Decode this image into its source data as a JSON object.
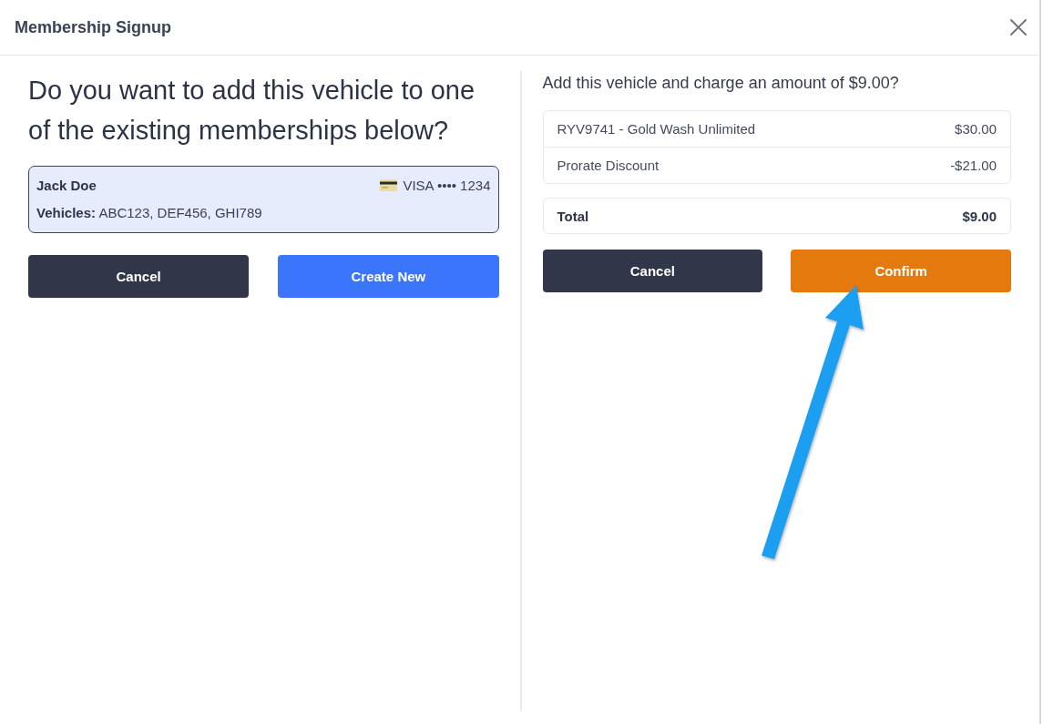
{
  "window": {
    "title": "Membership Signup"
  },
  "left": {
    "question": "Do you want to add this vehicle to one of the existing memberships below?",
    "memberships": [
      {
        "name": "Jack Doe",
        "card": "VISA •••• 1234",
        "vehicles": "**Vehicles:** ABC123, DEF456, GHI789",
        "selected": true
      }
    ],
    "buttons": [
      {
        "label": "Cancel",
        "kind": "secondary"
      },
      {
        "label": "Create New",
        "kind": "primary"
      }
    ]
  },
  "right": {
    "question": "Add this vehicle and charge an amount of $9.00?",
    "line_items": [
      {
        "label": "RYV9741 - Gold Wash Unlimited",
        "amount": "$30.00"
      },
      {
        "label": "Prorate Discount",
        "amount": "-$21.00"
      }
    ],
    "total": {
      "label": "Total",
      "amount": "$9.00"
    },
    "buttons": [
      {
        "label": "Cancel",
        "kind": "secondary"
      },
      {
        "label": "Confirm",
        "kind": "confirm"
      }
    ]
  }
}
